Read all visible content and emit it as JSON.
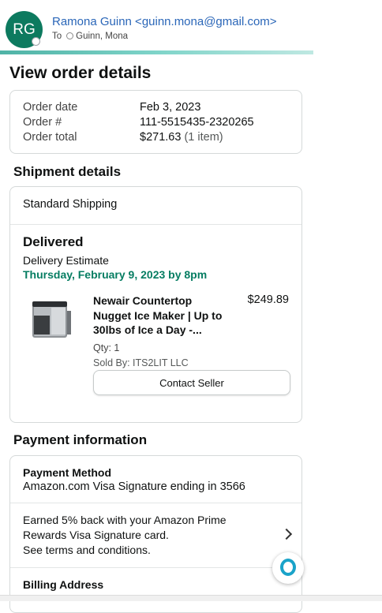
{
  "email": {
    "avatar_initials": "RG",
    "sender": "Ramona Guinn <guinn.mona@gmail.com>",
    "to_label": "To",
    "recipient": "Guinn, Mona"
  },
  "page": {
    "title": "View order details"
  },
  "summary": {
    "rows": [
      {
        "label": "Order date",
        "value": "Feb 3, 2023",
        "extra": ""
      },
      {
        "label": "Order #",
        "value": "111-5515435-2320265",
        "extra": ""
      },
      {
        "label": "Order total",
        "value": "$271.63",
        "extra": "(1 item)"
      }
    ]
  },
  "shipment": {
    "title": "Shipment details",
    "method": "Standard Shipping",
    "status": "Delivered",
    "estimate_label": "Delivery Estimate",
    "estimate_date": "Thursday, February 9, 2023 by 8pm",
    "item": {
      "title": "Newair Countertop Nugget Ice Maker | Up to 30lbs of Ice a Day -...",
      "price": "$249.89",
      "qty": "Qty: 1",
      "seller": "Sold By: ITS2LIT LLC",
      "contact_button": "Contact Seller"
    }
  },
  "payment": {
    "title": "Payment information",
    "method_label": "Payment Method",
    "method_value": "Amazon.com Visa Signature ending in 3566",
    "rewards_line1": "Earned 5% back with your Amazon Prime",
    "rewards_line2": "Rewards Visa Signature card.",
    "rewards_line3": "See terms and conditions.",
    "billing_label": "Billing Address"
  },
  "colors": {
    "accent_green": "#067d62",
    "link_blue": "#2a66b8",
    "avatar_bg": "#0d7a5f",
    "assistant_ring": "#1aa3c9"
  }
}
